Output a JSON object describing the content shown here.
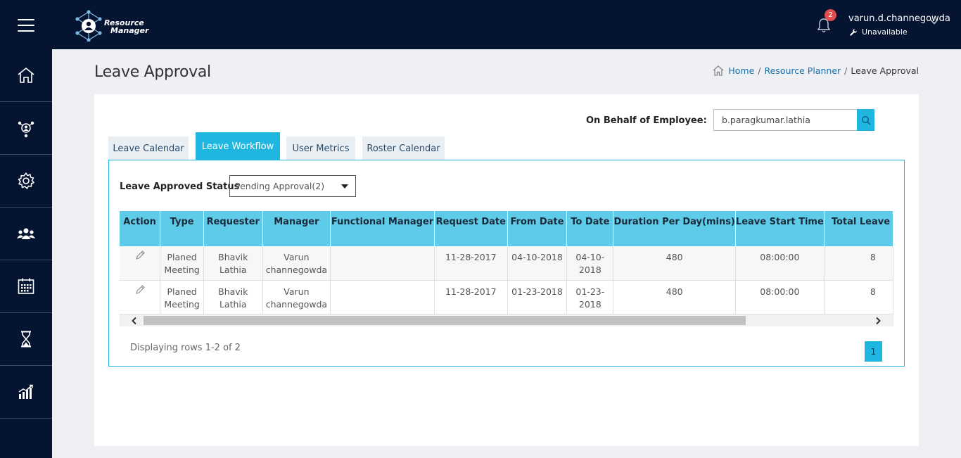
{
  "app": {
    "logo_line1": "Resource",
    "logo_line2": "Manager"
  },
  "header": {
    "notification_count": "2",
    "user_name": "varun.d.channegowda",
    "user_status": "Unavailable"
  },
  "sidenav": {
    "items": [
      {
        "icon": "home-icon"
      },
      {
        "icon": "team-network-icon"
      },
      {
        "icon": "gear-icon"
      },
      {
        "icon": "users-group-icon"
      },
      {
        "icon": "calendar-icon"
      },
      {
        "icon": "hourglass-icon"
      },
      {
        "icon": "bar-chart-icon"
      }
    ]
  },
  "page": {
    "title": "Leave Approval",
    "breadcrumb": {
      "home": "Home",
      "planner": "Resource Planner",
      "current": "Leave Approval",
      "separator": "/"
    }
  },
  "behalf": {
    "label": "On Behalf of Employee:",
    "value": "b.paragkumar.lathia"
  },
  "tabs": [
    {
      "label": "Leave Calendar",
      "active": false
    },
    {
      "label": "Leave Workflow",
      "active": true
    },
    {
      "label": "User Metrics",
      "active": false
    },
    {
      "label": "Roster Calendar",
      "active": false
    }
  ],
  "status_filter": {
    "label": "Leave Approved Status",
    "selected": "Pending Approval(2)"
  },
  "table": {
    "headers": [
      "Action",
      "Type",
      "Requester",
      "Manager",
      "Functional Manager",
      "Request Date",
      "From Date",
      "To Date",
      "Duration Per Day(mins)",
      "Leave Start Time",
      "Total Leave"
    ],
    "rows": [
      {
        "type": "Planed Meeting",
        "requester": "Bhavik Lathia",
        "manager": "Varun channegowda",
        "functional_manager": "",
        "request_date": "11-28-2017",
        "from_date": "04-10-2018",
        "to_date": "04-10-2018",
        "duration": "480",
        "start_time": "08:00:00",
        "total": "8"
      },
      {
        "type": "Planed Meeting",
        "requester": "Bhavik Lathia",
        "manager": "Varun channegowda",
        "functional_manager": "",
        "request_date": "11-28-2017",
        "from_date": "01-23-2018",
        "to_date": "01-23-2018",
        "duration": "480",
        "start_time": "08:00:00",
        "total": "8"
      }
    ]
  },
  "footer": {
    "rows_info": "Displaying rows 1-2 of 2",
    "current_page": "1"
  },
  "colors": {
    "nav_bg": "#051431",
    "accent": "#1fb7e0",
    "header_row": "#5ecbe8",
    "badge": "#e24d4d"
  }
}
